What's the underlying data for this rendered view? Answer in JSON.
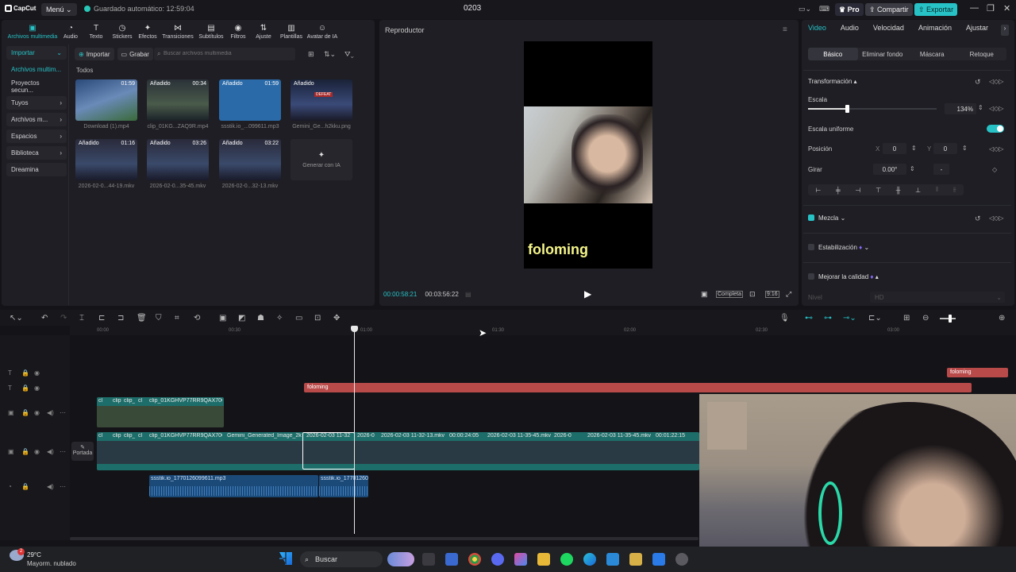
{
  "titlebar": {
    "logo": "CapCut",
    "menu": "Menú",
    "autosave": "Guardado automático: 12:59:04",
    "project": "0203",
    "pro": "Pro",
    "share": "Compartir",
    "export": "Exportar"
  },
  "top_tools": [
    {
      "label": "Archivos multimedia",
      "icon": "media-icon"
    },
    {
      "label": "Audio",
      "icon": "audio-icon"
    },
    {
      "label": "Texto",
      "icon": "text-icon"
    },
    {
      "label": "Stickers",
      "icon": "sticker-icon"
    },
    {
      "label": "Efectos",
      "icon": "effects-icon"
    },
    {
      "label": "Transiciones",
      "icon": "transition-icon"
    },
    {
      "label": "Subtítulos",
      "icon": "subtitle-icon"
    },
    {
      "label": "Filtros",
      "icon": "filter-icon"
    },
    {
      "label": "Ajuste",
      "icon": "adjust-icon"
    },
    {
      "label": "Plantillas",
      "icon": "template-icon"
    },
    {
      "label": "Avatar de IA",
      "icon": "avatar-icon"
    }
  ],
  "sidebar": {
    "items": [
      {
        "label": "Importar"
      },
      {
        "label": "Archivos multim..."
      },
      {
        "label": "Proyectos secun..."
      },
      {
        "label": "Tuyos"
      },
      {
        "label": "Archivos m..."
      },
      {
        "label": "Espacios"
      },
      {
        "label": "Biblioteca"
      },
      {
        "label": "Dreamina"
      }
    ]
  },
  "media": {
    "import": "Importar",
    "record": "Grabar",
    "search_placeholder": "Buscar archivos multimedia",
    "section": "Todos",
    "items": [
      {
        "tag": "",
        "duration": "01:59",
        "name": "Download (1).mp4"
      },
      {
        "tag": "Añadido",
        "duration": "00:34",
        "name": "clip_01KG...ZAQ9R.mp4"
      },
      {
        "tag": "Añadido",
        "duration": "01:59",
        "name": "ssstik.io_...099611.mp3"
      },
      {
        "tag": "Añadido",
        "duration": "",
        "name": "Gemini_Ge...h2kku.png"
      },
      {
        "tag": "Añadido",
        "duration": "01:16",
        "name": "2026-02-0...44-19.mkv"
      },
      {
        "tag": "Añadido",
        "duration": "03:26",
        "name": "2026-02-0...35-45.mkv"
      },
      {
        "tag": "Añadido",
        "duration": "03:22",
        "name": "2026-02-0...32-13.mkv"
      }
    ],
    "generate": "Generar con IA",
    "defeat": "DEFEAT"
  },
  "player": {
    "title": "Reproductor",
    "caption": "foloming",
    "current": "00:00:58:21",
    "total": "00:03:56:22",
    "full": "Completa",
    "ratio": "9:16"
  },
  "right_panel": {
    "tabs": [
      "Video",
      "Audio",
      "Velocidad",
      "Animación",
      "Ajustar",
      "E"
    ],
    "subtabs": [
      "Básico",
      "Eliminar fondo",
      "Máscara",
      "Retoque"
    ],
    "transform": "Transformación",
    "scale_label": "Escala",
    "scale_value": "134%",
    "scale_fraction": 0.3,
    "uniform_scale": "Escala uniforme",
    "position": "Posición",
    "x_label": "X",
    "x_value": "0",
    "y_label": "Y",
    "y_value": "0",
    "rotate": "Girar",
    "rotate_value": "0.00°",
    "rotate_dash": "-",
    "blend": "Mezcla",
    "stabilize": "Estabilización",
    "improve": "Mejorar la calidad",
    "level": "Nivel",
    "level_value": "HD"
  },
  "timeline": {
    "ruler": [
      "00:00",
      "00:30",
      "01:00",
      "01:30",
      "02:00",
      "02:30",
      "03:00"
    ],
    "text_clip_1": "foloming",
    "text_clip_2": "foloming",
    "cover": "Portada",
    "overlay_clips": [
      "cl",
      "clip",
      "clip_l",
      "cl",
      "clip_01KGHVP77RR9QAX70CW"
    ],
    "main_clips": [
      "cl",
      "clip",
      "clip_l",
      "cl",
      "clip_01KGHVP77RR9QAX70CW",
      "Gemini_Generated_Image_2kk",
      "2026-02-03 11-32",
      "2026-0",
      "2026-02-03 11-32-13.mkv",
      "00:00:24:05",
      "2026-02-03 11-35-45.mkv",
      "2026-0",
      "2026-02-03 11-35-45.mkv",
      "00:01:22:15"
    ],
    "audio_clips": [
      "ssstik.io_1770126099611.mp3",
      "ssstik.io_17701260"
    ]
  },
  "taskbar": {
    "temp": "29°C",
    "weather": "Mayorm. nublado",
    "search": "Buscar",
    "badge": "2"
  },
  "colors": {
    "accent": "#27c2c6",
    "text_clip": "#b94a4a",
    "video_track": "#1d6e6a",
    "audio_track": "#1c4a78"
  }
}
